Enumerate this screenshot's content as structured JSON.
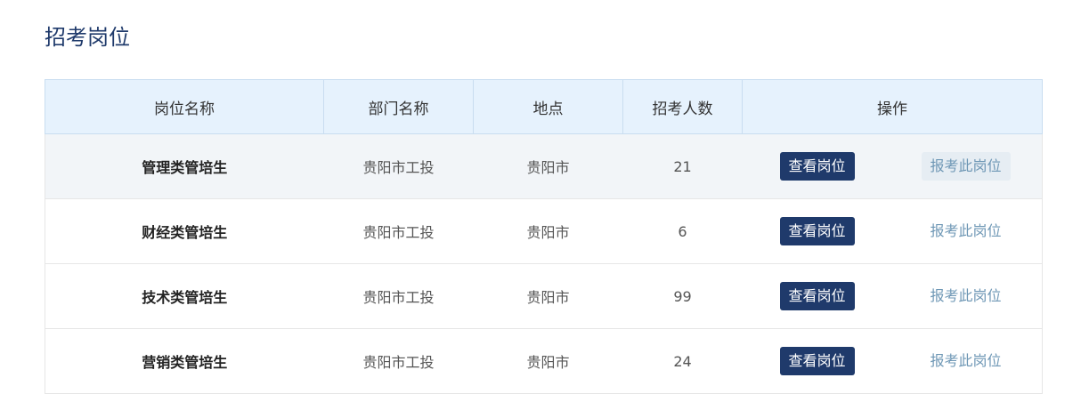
{
  "page": {
    "title": "招考岗位"
  },
  "table": {
    "headers": [
      "岗位名称",
      "部门名称",
      "地点",
      "招考人数",
      "操作"
    ],
    "rows": [
      {
        "name": "管理类管培生",
        "dept": "贵阳市工投",
        "location": "贵阳市",
        "count": "21",
        "view_label": "查看岗位",
        "apply_label": "报考此岗位",
        "highlighted": true
      },
      {
        "name": "财经类管培生",
        "dept": "贵阳市工投",
        "location": "贵阳市",
        "count": "6",
        "view_label": "查看岗位",
        "apply_label": "报考此岗位",
        "highlighted": false
      },
      {
        "name": "技术类管培生",
        "dept": "贵阳市工投",
        "location": "贵阳市",
        "count": "99",
        "view_label": "查看岗位",
        "apply_label": "报考此岗位",
        "highlighted": false
      },
      {
        "name": "营销类管培生",
        "dept": "贵阳市工投",
        "location": "贵阳市",
        "count": "24",
        "view_label": "查看岗位",
        "apply_label": "报考此岗位",
        "highlighted": false
      }
    ]
  },
  "colors": {
    "primary": "#1f3a6b",
    "header_bg": "#e6f2fd",
    "link": "#6e97b5",
    "row_highlight": "#f2f5f8"
  }
}
